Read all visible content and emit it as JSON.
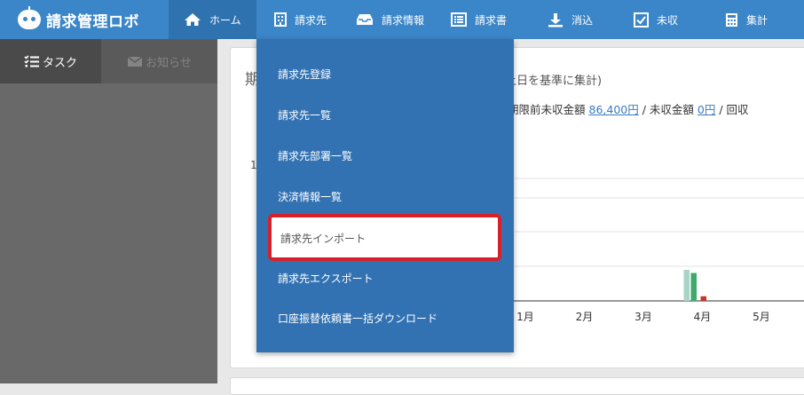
{
  "app": {
    "title": "請求管理ロボ"
  },
  "nav": {
    "items": [
      {
        "label": "ホーム",
        "icon": "home-icon"
      },
      {
        "label": "請求先",
        "icon": "building-icon"
      },
      {
        "label": "請求情報",
        "icon": "inbox-icon"
      },
      {
        "label": "請求書",
        "icon": "document-list-icon"
      },
      {
        "label": "消込",
        "icon": "download-icon"
      },
      {
        "label": "未収",
        "icon": "checkbox-icon"
      },
      {
        "label": "集計",
        "icon": "calculator-icon"
      }
    ]
  },
  "sidebar": {
    "tabs": [
      {
        "label": "タスク",
        "icon": "task-list-icon"
      },
      {
        "label": "お知らせ",
        "icon": "mail-icon"
      }
    ]
  },
  "card": {
    "title_visible": "期",
    "title_tail": "上日を基準に集計)",
    "summary": {
      "label1": "期限前未収金額",
      "value1": "86,400円",
      "sep1": " / ",
      "label2": "未収金額",
      "value2": "0円",
      "sep2": " / ",
      "label3": "回収"
    }
  },
  "dropdown": {
    "items": [
      "請求先登録",
      "請求先一覧",
      "請求先部署一覧",
      "決済情報一覧",
      "請求先インポート",
      "請求先エクスポート",
      "口座振替依頼書一括ダウンロード"
    ]
  },
  "chart_data": {
    "type": "bar",
    "categories": [
      "1月",
      "2月",
      "3月",
      "4月",
      "5月"
    ],
    "visible_y_tick": "1",
    "series": [
      {
        "values": [
          0,
          0,
          0,
          1,
          0
        ]
      },
      {
        "values": [
          0,
          0,
          0,
          0.9,
          0
        ]
      },
      {
        "values": [
          0,
          0,
          0,
          0.15,
          0
        ]
      }
    ],
    "colors": [
      "#a8d5c8",
      "#3daa6c",
      "#c0392b"
    ]
  },
  "colors": {
    "nav_bg": "#3b86c8",
    "dropdown_bg": "#3272b3",
    "highlight_border": "#d7202a",
    "sidebar_bg": "#696969"
  }
}
